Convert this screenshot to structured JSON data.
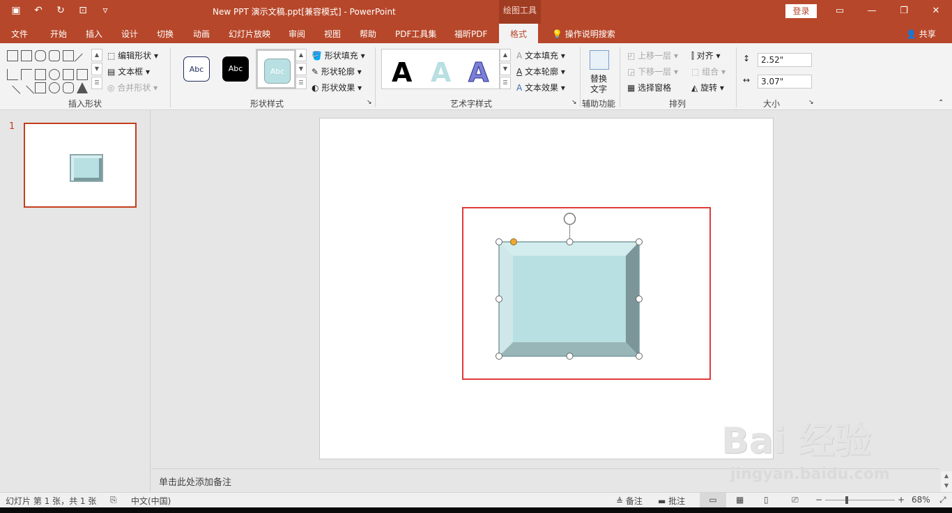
{
  "title": {
    "doc": "New PPT 演示文稿.ppt[兼容模式]  -  PowerPoint",
    "tools_badge": "绘图工具",
    "login": "登录",
    "share": "共享"
  },
  "tabs": [
    "文件",
    "开始",
    "插入",
    "设计",
    "切换",
    "动画",
    "幻灯片放映",
    "审阅",
    "视图",
    "帮助",
    "PDF工具集",
    "福昕PDF",
    "格式",
    "操作说明搜索"
  ],
  "active_tab": "格式",
  "ribbon": {
    "insert_shapes": {
      "label": "插入形状",
      "edit_shape": "编辑形状",
      "text_box": "文本框",
      "merge_shapes": "合并形状"
    },
    "shape_styles": {
      "label": "形状样式",
      "abc": "Abc",
      "fill": "形状填充",
      "outline": "形状轮廓",
      "effects": "形状效果"
    },
    "wordart": {
      "label": "艺术字样式",
      "letter": "A",
      "text_fill": "文本填充",
      "text_outline": "文本轮廓",
      "text_effects": "文本效果"
    },
    "accessibility": {
      "label": "辅助功能",
      "alt_text_1": "替换",
      "alt_text_2": "文字"
    },
    "arrange": {
      "label": "排列",
      "bring_forward": "上移一层",
      "send_backward": "下移一层",
      "selection_pane": "选择窗格",
      "align": "对齐",
      "group": "组合",
      "rotate": "旋转"
    },
    "size": {
      "label": "大小",
      "height": "2.52\"",
      "width": "3.07\""
    }
  },
  "slides": {
    "number": "1"
  },
  "notes": {
    "placeholder": "单击此处添加备注"
  },
  "status": {
    "slide_info": "幻灯片 第 1 张，共 1 张",
    "language": "中文(中国)",
    "notes": "备注",
    "comments": "批注",
    "zoom": "68%"
  },
  "watermark": {
    "main": "Bai 经验",
    "sub": "jingyan.baidu.com"
  },
  "colors": {
    "brand": "#b7472a",
    "shape_fill": "#b8dfe2",
    "selection_red": "#e03a3a"
  }
}
